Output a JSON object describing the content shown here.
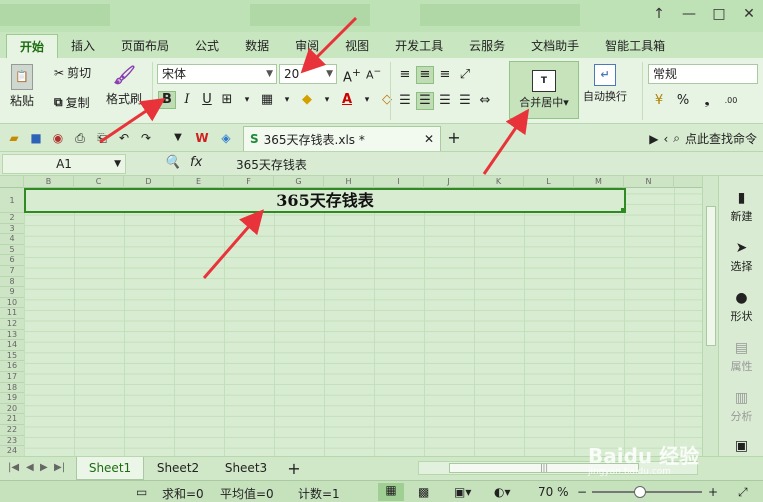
{
  "window": {
    "minimize": "—",
    "maximize": "□",
    "close": "✕",
    "restore_icon": "↑"
  },
  "tabs": [
    "开始",
    "插入",
    "页面布局",
    "公式",
    "数据",
    "审阅",
    "视图",
    "开发工具",
    "云服务",
    "文档助手",
    "智能工具箱"
  ],
  "ribbon": {
    "paste": "粘贴",
    "cut": "剪切",
    "copy": "复制",
    "format_painter": "格式刷",
    "font_name": "宋体",
    "font_size": "20",
    "bold": "B",
    "italic": "I",
    "underline": "U",
    "merge_center": "合并居中",
    "wrap_text": "自动换行",
    "number_format": "常规",
    "percent": "%",
    "comma": "❟",
    "decimal": ".00"
  },
  "doc_tab": {
    "name": "365天存钱表.xls *"
  },
  "find_command": "点此查找命令",
  "formula_bar": {
    "cell_ref": "A1",
    "fx": "fx",
    "content": "365天存钱表"
  },
  "columns": [
    "B",
    "C",
    "D",
    "E",
    "F",
    "G",
    "H",
    "I",
    "J",
    "K",
    "L",
    "M",
    "N"
  ],
  "rows": [
    "1",
    "2",
    "3",
    "4",
    "5",
    "6",
    "7",
    "8",
    "9",
    "10",
    "11",
    "12",
    "13",
    "14",
    "15",
    "16",
    "17",
    "18",
    "19",
    "20",
    "21",
    "22",
    "23",
    "24"
  ],
  "merged_cell_text": "365天存钱表",
  "right_panel": [
    "新建",
    "选择",
    "形状",
    "属性",
    "分析",
    "传图"
  ],
  "sheets": [
    "Sheet1",
    "Sheet2",
    "Sheet3"
  ],
  "add_sheet": "+",
  "status": {
    "sum": "求和=0",
    "average": "平均值=0",
    "count": "计数=1",
    "zoom": "70 %"
  },
  "watermark": {
    "brand": "Baidu 经验",
    "url": "jingyan.baidu.com"
  },
  "colors": {
    "accent": "#2f8a24",
    "arrow": "#e8333a",
    "theme": "#d9ecd3"
  }
}
